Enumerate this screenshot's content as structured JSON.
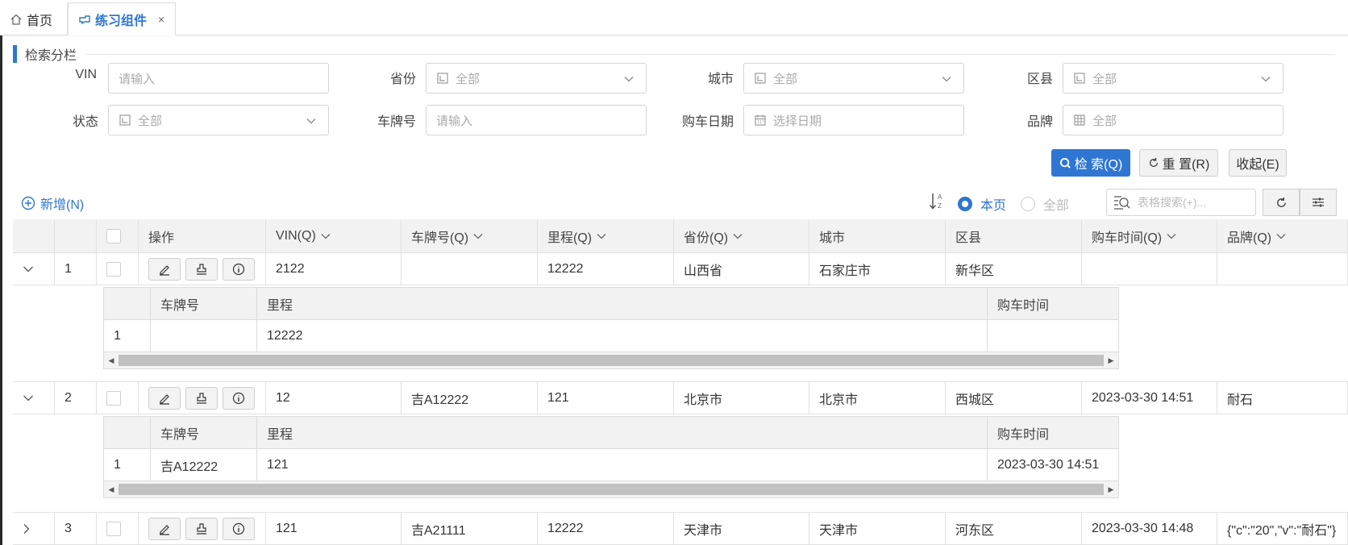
{
  "tabs": {
    "home": "首页",
    "active": "练习组件",
    "close": "×"
  },
  "section": {
    "title": "检索分栏"
  },
  "form": {
    "vin": {
      "label": "VIN",
      "placeholder": "请输入"
    },
    "province": {
      "label": "省份",
      "value": "全部"
    },
    "city": {
      "label": "城市",
      "value": "全部"
    },
    "district": {
      "label": "区县",
      "value": "全部"
    },
    "status": {
      "label": "状态",
      "value": "全部"
    },
    "plate": {
      "label": "车牌号",
      "placeholder": "请输入"
    },
    "buy_date": {
      "label": "购车日期",
      "placeholder": "选择日期"
    },
    "brand": {
      "label": "品牌",
      "value": "全部"
    }
  },
  "buttons": {
    "search": "检 索(Q)",
    "reset": "重 置(R)",
    "collapse": "收起(E)"
  },
  "toolbar": {
    "add": "新增(N)",
    "this_page": "本页",
    "all": "全部",
    "table_search_placeholder": "表格搜索(+)..."
  },
  "table": {
    "headers": {
      "ops": "操作",
      "vin": "VIN(Q)",
      "plate": "车牌号(Q)",
      "mileage": "里程(Q)",
      "province": "省份(Q)",
      "city": "城市",
      "district": "区县",
      "buy_time": "购车时间(Q)",
      "brand": "品牌(Q)"
    },
    "rows": [
      {
        "no": "1",
        "vin": "2122",
        "plate": "",
        "mileage": "12222",
        "province": "山西省",
        "city": "石家庄市",
        "district": "新华区",
        "buy_time": "",
        "brand": ""
      },
      {
        "no": "2",
        "vin": "12",
        "plate": "吉A12222",
        "mileage": "121",
        "province": "北京市",
        "city": "北京市",
        "district": "西城区",
        "buy_time": "2023-03-30 14:51",
        "brand": "耐石"
      },
      {
        "no": "3",
        "vin": "121",
        "plate": "吉A21111",
        "mileage": "12222",
        "province": "天津市",
        "city": "天津市",
        "district": "河东区",
        "buy_time": "2023-03-30 14:48",
        "brand": "{\"c\":\"20\",\"v\":\"耐石\"}"
      }
    ],
    "sub_headers": {
      "plate": "车牌号",
      "mileage": "里程",
      "buy_time": "购车时间"
    },
    "sub_rows": [
      {
        "no": "1",
        "plate": "",
        "mileage": "12222",
        "buy_time": ""
      },
      {
        "no": "1",
        "plate": "吉A12222",
        "mileage": "121",
        "buy_time": "2023-03-30 14:51"
      }
    ]
  },
  "colors": {
    "accent": "#2f76d2",
    "header_bg": "#f2f2f2",
    "border": "#e2e2e2"
  }
}
